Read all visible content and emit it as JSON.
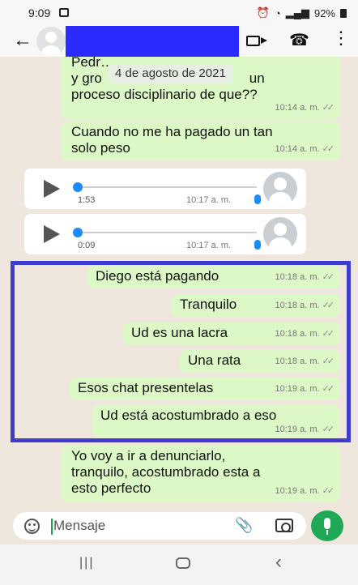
{
  "status_bar": {
    "time": "9:09",
    "battery": "92%"
  },
  "header": {
    "back_icon": "arrow-left-icon",
    "video_icon": "video-call-icon",
    "call_icon": "phone-icon",
    "menu_icon": "more-vert-icon"
  },
  "chat": {
    "date_chip": "4 de agosto de 2021",
    "messages": [
      {
        "text": "Pedr...\ny gro",
        "partial": true
      },
      {
        "text": "un\nproceso disciplinario de que??",
        "time": "10:14 a. m."
      },
      {
        "text": "Cuando no me ha pagado un tan\nsolo peso",
        "time": "10:14 a. m."
      },
      {
        "type": "audio",
        "duration": "1:53",
        "time": "10:17 a. m."
      },
      {
        "type": "audio",
        "duration": "0:09",
        "time": "10:17 a. m."
      },
      {
        "text": "Diego está pagando",
        "time": "10:18 a. m."
      },
      {
        "text": "Tranquilo",
        "time": "10:18 a. m."
      },
      {
        "text": "Ud es una lacra",
        "time": "10:18 a. m."
      },
      {
        "text": "Una rata",
        "time": "10:18 a. m."
      },
      {
        "text": "Esos chat presentelas",
        "time": "10:19 a. m."
      },
      {
        "text": "Ud está acostumbrado a eso",
        "time": "10:19 a. m."
      },
      {
        "text": "Yo voy a ir a denunciarlo,\ntranquilo, acostumbrado esta a\nesto perfecto",
        "time": "10:19 a. m."
      }
    ],
    "highlight_color": "#3c3ccd",
    "bubble_color": "#dcf8c6",
    "background_color": "#efe7dd"
  },
  "input": {
    "placeholder": "Mensaje",
    "emoji_icon": "emoji-icon",
    "attach_icon": "paperclip-icon",
    "camera_icon": "camera-icon",
    "mic_icon": "mic-icon",
    "accent_color": "#1fa855"
  },
  "nav": {
    "recent_icon": "recent-apps-icon",
    "home_icon": "home-icon",
    "back_icon": "back-icon"
  }
}
